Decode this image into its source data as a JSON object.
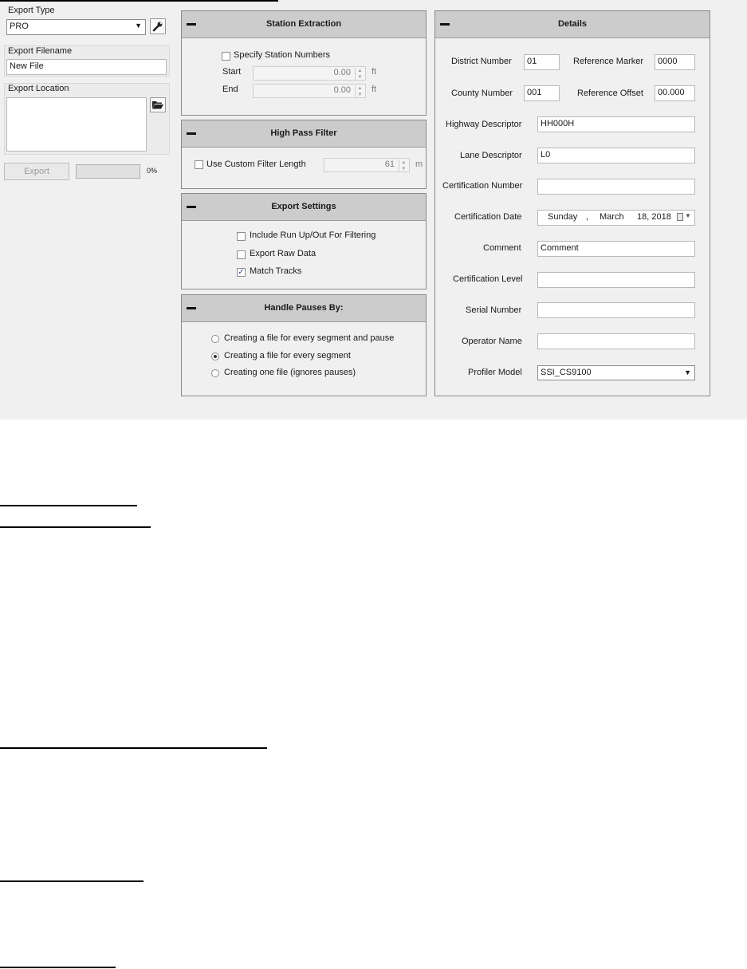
{
  "left": {
    "export_type_label": "Export Type",
    "export_type_value": "PRO",
    "export_filename_label": "Export Filename",
    "export_filename_value": "New File",
    "export_location_label": "Export Location",
    "export_location_value": "",
    "export_button": "Export",
    "progress": 0,
    "progress_text": "0%"
  },
  "station": {
    "title": "Station Extraction",
    "specify_label": "Specify Station Numbers",
    "specify_checked": false,
    "start_label": "Start",
    "start_value": "0.00",
    "end_label": "End",
    "end_value": "0.00",
    "unit": "ft"
  },
  "highpass": {
    "title": "High Pass Filter",
    "custom_label": "Use Custom Filter Length",
    "custom_checked": false,
    "value": "61",
    "unit": "m"
  },
  "settings": {
    "title": "Export Settings",
    "items": [
      {
        "label": "Include Run Up/Out For Filtering",
        "checked": false
      },
      {
        "label": "Export Raw Data",
        "checked": false
      },
      {
        "label": "Match Tracks",
        "checked": true
      }
    ]
  },
  "pauses": {
    "title": "Handle Pauses By:",
    "options": [
      {
        "label": "Creating a file for every segment and pause",
        "selected": false
      },
      {
        "label": "Creating a file for every segment",
        "selected": true
      },
      {
        "label": "Creating one file (ignores pauses)",
        "selected": false
      }
    ]
  },
  "details": {
    "title": "Details",
    "district_label": "District Number",
    "district_value": "01",
    "refmarker_label": "Reference Marker",
    "refmarker_value": "0000",
    "county_label": "County Number",
    "county_value": "001",
    "refoffset_label": "Reference Offset",
    "refoffset_value": "00.000",
    "highway_label": "Highway Descriptor",
    "highway_value": "HH000H",
    "lane_label": "Lane Descriptor",
    "lane_value": "L0",
    "certnum_label": "Certification Number",
    "certnum_value": "",
    "certdate_label": "Certification Date",
    "certdate_day": "Sunday",
    "certdate_sep": ",",
    "certdate_month": "March",
    "certdate_rest": "18, 2018",
    "comment_label": "Comment",
    "comment_value": "Comment",
    "certlevel_label": "Certification Level",
    "certlevel_value": "",
    "serial_label": "Serial Number",
    "serial_value": "",
    "operator_label": "Operator Name",
    "operator_value": "",
    "profiler_label": "Profiler Model",
    "profiler_value": "SSI_CS9100"
  }
}
